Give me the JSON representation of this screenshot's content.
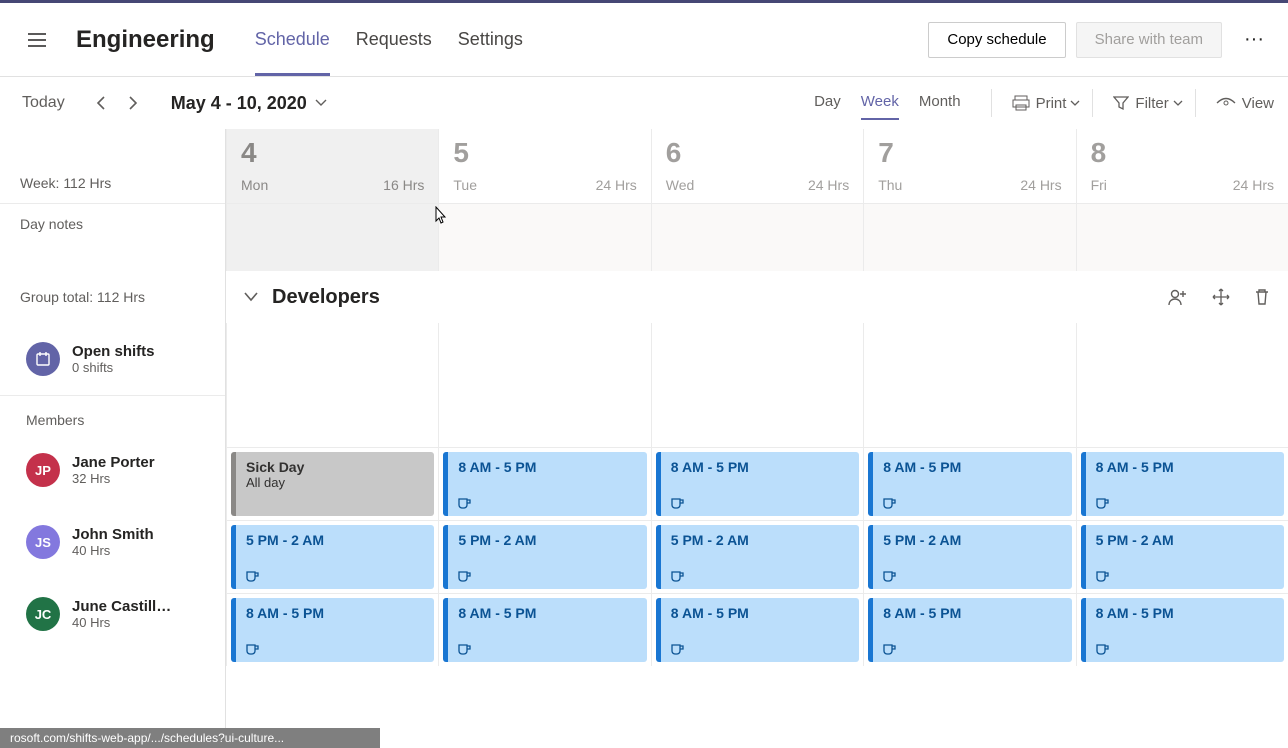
{
  "header": {
    "team_name": "Engineering",
    "tabs": [
      "Schedule",
      "Requests",
      "Settings"
    ],
    "active_tab": 0,
    "copy_button": "Copy schedule",
    "share_button": "Share with team"
  },
  "toolbar": {
    "today": "Today",
    "date_range": "May 4 - 10, 2020",
    "views": [
      "Day",
      "Week",
      "Month"
    ],
    "active_view": 1,
    "print": "Print",
    "filter": "Filter",
    "view": "View"
  },
  "left": {
    "week_hours": "Week: 112 Hrs",
    "day_notes": "Day notes",
    "group_total": "Group total: 112 Hrs",
    "open_shifts": {
      "title": "Open shifts",
      "sub": "0 shifts"
    },
    "members_label": "Members",
    "members": [
      {
        "initials": "JP",
        "name": "Jane Porter",
        "hours": "32 Hrs",
        "color": "av-red"
      },
      {
        "initials": "JS",
        "name": "John Smith",
        "hours": "40 Hrs",
        "color": "av-violet"
      },
      {
        "initials": "JC",
        "name": "June Castill…",
        "hours": "40 Hrs",
        "color": "av-green"
      }
    ]
  },
  "days": [
    {
      "num": "4",
      "dow": "Mon",
      "hrs": "16 Hrs",
      "past": true
    },
    {
      "num": "5",
      "dow": "Tue",
      "hrs": "24 Hrs",
      "past": false
    },
    {
      "num": "6",
      "dow": "Wed",
      "hrs": "24 Hrs",
      "past": false
    },
    {
      "num": "7",
      "dow": "Thu",
      "hrs": "24 Hrs",
      "past": false
    },
    {
      "num": "8",
      "dow": "Fri",
      "hrs": "24 Hrs",
      "past": false
    }
  ],
  "group": {
    "name": "Developers"
  },
  "shifts": {
    "jane": [
      {
        "label": "Sick Day",
        "sub": "All day",
        "type": "grey"
      },
      {
        "label": "8 AM - 5 PM",
        "type": "blue"
      },
      {
        "label": "8 AM - 5 PM",
        "type": "blue"
      },
      {
        "label": "8 AM - 5 PM",
        "type": "blue"
      },
      {
        "label": "8 AM - 5 PM",
        "type": "blue"
      }
    ],
    "john": [
      {
        "label": "5 PM - 2 AM",
        "type": "blue"
      },
      {
        "label": "5 PM - 2 AM",
        "type": "blue"
      },
      {
        "label": "5 PM - 2 AM",
        "type": "blue"
      },
      {
        "label": "5 PM - 2 AM",
        "type": "blue"
      },
      {
        "label": "5 PM - 2 AM",
        "type": "blue"
      }
    ],
    "june": [
      {
        "label": "8 AM - 5 PM",
        "type": "blue"
      },
      {
        "label": "8 AM - 5 PM",
        "type": "blue"
      },
      {
        "label": "8 AM - 5 PM",
        "type": "blue"
      },
      {
        "label": "8 AM - 5 PM",
        "type": "blue"
      },
      {
        "label": "8 AM - 5 PM",
        "type": "blue"
      }
    ]
  },
  "statusbar": "rosoft.com/shifts-web-app/.../schedules?ui-culture..."
}
